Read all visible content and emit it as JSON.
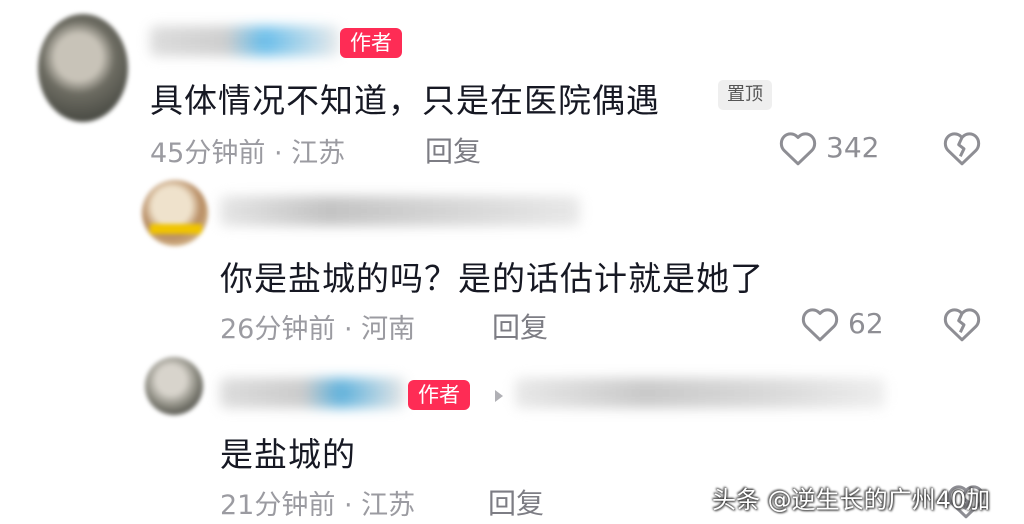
{
  "comments": [
    {
      "author_tag": "作者",
      "text": "具体情况不知道，只是在医院偶遇",
      "pinned_label": "置顶",
      "time": "45分钟前 · 江苏",
      "reply_label": "回复",
      "likes": "342"
    },
    {
      "text": "你是盐城的吗？是的话估计就是她了",
      "time": "26分钟前 · 河南",
      "reply_label": "回复",
      "likes": "62"
    },
    {
      "author_tag": "作者",
      "text": "是盐城的",
      "time": "21分钟前 · 江苏",
      "reply_label": "回复"
    }
  ],
  "watermark": "头条 @逆生长的广州40加",
  "icons": [
    "heart-outline-icon",
    "broken-heart-icon",
    "reply-arrow-icon"
  ],
  "colors": {
    "author_tag_bg": "#fe2c55",
    "text": "#161823",
    "meta": "#9b9ba1"
  }
}
